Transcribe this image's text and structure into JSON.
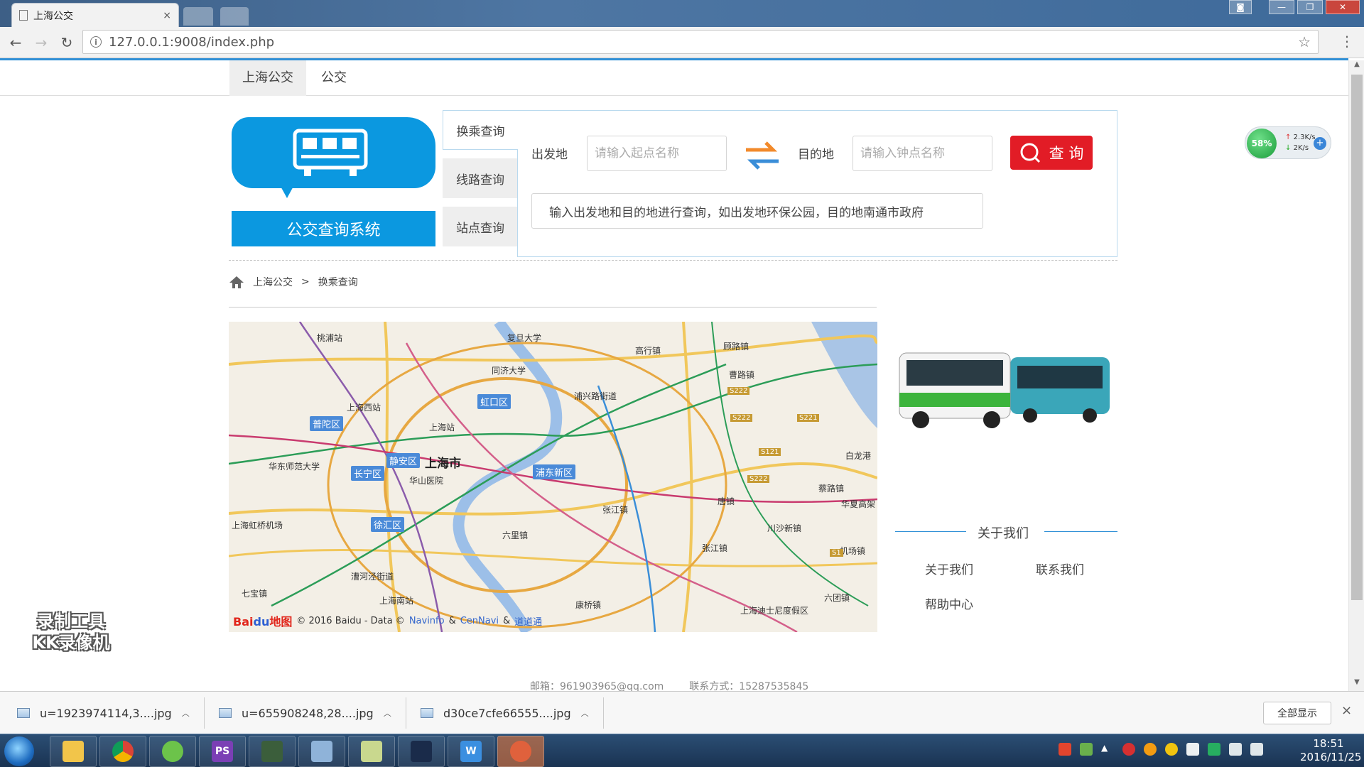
{
  "browser": {
    "tab_title": "上海公交",
    "tab_close": "×",
    "url": "127.0.0.1:9008/index.php"
  },
  "nav": {
    "items": [
      "上海公交",
      "公交"
    ]
  },
  "logo": {
    "title": "公交查询系统"
  },
  "side_tabs": [
    "换乘查询",
    "线路查询",
    "站点查询"
  ],
  "query": {
    "from_label": "出发地",
    "from_placeholder": "请输入起点名称",
    "to_label": "目的地",
    "to_placeholder": "请输入钟点名称",
    "search_label": "查 询",
    "hint": "输入出发地和目的地进行查询，如出发地环保公园，目的地南通市政府"
  },
  "breadcrumb": {
    "home": "上海公交",
    "sep": ">",
    "current": "换乘查询"
  },
  "map": {
    "logo_text": "Bai",
    "logo_text2": "du",
    "logo_text3": "地图",
    "copyright": "© 2016 Baidu - Data ©",
    "provider1": "Navinfo",
    "amp": "&",
    "provider2": "CenNavi",
    "amp2": "&",
    "provider3": "道道通",
    "city": "上海市",
    "districts": [
      "虹口区",
      "普陀区",
      "静安区",
      "长宁区",
      "浦东新区",
      "徐汇区"
    ],
    "places": [
      "桃浦站",
      "复旦大学",
      "同济大学",
      "上海西站",
      "上海站",
      "华东师范大学",
      "上海虹桥机场",
      "华山医院",
      "张江镇",
      "六里镇",
      "漕河泾街道",
      "上海南站",
      "七宝镇",
      "高行镇",
      "顾路镇",
      "曹路镇",
      "唐镇",
      "川沙新镇",
      "张江镇",
      "康桥镇",
      "六团镇",
      "白龙港",
      "机场镇",
      "上海迪士尼度假区",
      "浦兴路街道",
      "华夏高架",
      "蔡路镇"
    ],
    "roads": [
      "S222",
      "S221",
      "S121",
      "S222",
      "S1",
      "S222"
    ]
  },
  "about": {
    "title": "关于我们",
    "links": [
      "关于我们",
      "联系我们",
      "帮助中心"
    ]
  },
  "footer": {
    "email": "邮箱：961903965@qq.com",
    "contact": "联系方式：15287535845"
  },
  "net_widget": {
    "percent": "58%",
    "up": "2.3K/s",
    "down": "2K/s",
    "plus": "+"
  },
  "watermark": {
    "line1": "录制工具",
    "line2": "KK录像机"
  },
  "downloads": {
    "items": [
      "u=1923974114,3....jpg",
      "u=655908248,28....jpg",
      "d30ce7cfe66555....jpg"
    ],
    "show_all": "全部显示",
    "close": "×"
  },
  "taskbar": {
    "time": "18:51",
    "date": "2016/11/25"
  }
}
